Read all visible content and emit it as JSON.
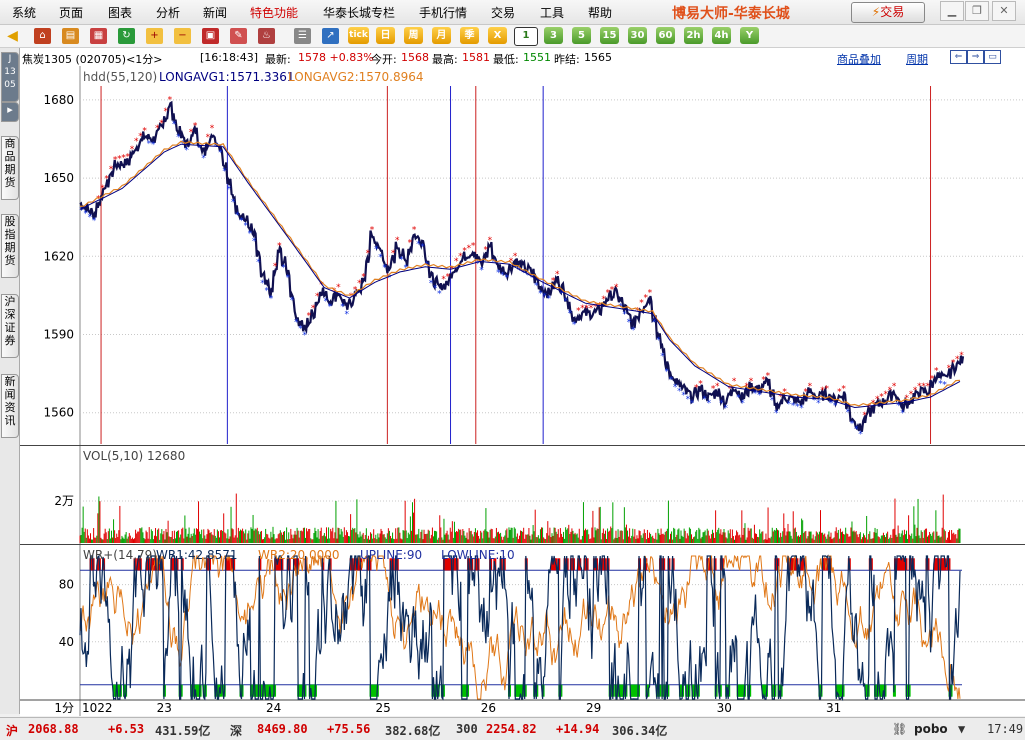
{
  "menu": {
    "items": [
      "系统",
      "页面",
      "图表",
      "分析",
      "新闻",
      "特色功能",
      "华泰长城专栏",
      "手机行情",
      "交易",
      "工具",
      "帮助"
    ],
    "special_index": 5,
    "app_title": "博易大师-华泰长城",
    "trade_button": "交易"
  },
  "toolbar": {
    "icon_labels": [
      "tick",
      "日",
      "周",
      "月",
      "季",
      "X"
    ],
    "periods": [
      "1",
      "3",
      "5",
      "15",
      "30",
      "60",
      "2h",
      "4h",
      "Y"
    ],
    "selected_period": "1"
  },
  "infobar": {
    "contract": "焦炭1305 (020705)<1分>",
    "time": "[16:18:43]",
    "last_label": "最新:",
    "last_value": "1578 +0.83%",
    "open_label": "今开:",
    "open_value": "1568",
    "high_label": "最高:",
    "high_value": "1581",
    "low_label": "最低:",
    "low_value": "1551",
    "prev_label": "昨结:",
    "prev_value": "1565",
    "overlay_link": "商品叠加",
    "period_link": "周期"
  },
  "left_tabs": {
    "code": "J 13 05",
    "tabs": [
      "商品期货",
      "股指期货",
      "沪深证券",
      "新闻资讯"
    ]
  },
  "chart_data": {
    "type": "line",
    "main": {
      "indicator_name": "hdd(55,120)",
      "series": [
        {
          "name": "LONGAVG1",
          "label": "LONGAVG1:1571.3361",
          "color": "#000080"
        },
        {
          "name": "LONGAVG2",
          "label": "LONGAVG2:1570.8964",
          "color": "#e08020"
        }
      ],
      "ylim": [
        1548,
        1693
      ],
      "yticks": [
        1680,
        1650,
        1620,
        1590,
        1560
      ],
      "price_path": [
        [
          0,
          1640
        ],
        [
          3,
          1636
        ],
        [
          5,
          1644
        ],
        [
          8,
          1655
        ],
        [
          11,
          1656
        ],
        [
          13,
          1662
        ],
        [
          15,
          1666
        ],
        [
          17,
          1665
        ],
        [
          19,
          1669
        ],
        [
          21,
          1678
        ],
        [
          23,
          1668
        ],
        [
          25,
          1663
        ],
        [
          27,
          1668
        ],
        [
          29,
          1660
        ],
        [
          31,
          1667
        ],
        [
          33,
          1662
        ],
        [
          35,
          1648
        ],
        [
          37,
          1638
        ],
        [
          39,
          1634
        ],
        [
          41,
          1628
        ],
        [
          43,
          1612
        ],
        [
          45,
          1606
        ],
        [
          47,
          1622
        ],
        [
          49,
          1614
        ],
        [
          51,
          1597
        ],
        [
          53,
          1592
        ],
        [
          55,
          1598
        ],
        [
          57,
          1607
        ],
        [
          59,
          1603
        ],
        [
          61,
          1606
        ],
        [
          63,
          1600
        ],
        [
          65,
          1605
        ],
        [
          67,
          1610
        ],
        [
          69,
          1628
        ],
        [
          71,
          1622
        ],
        [
          73,
          1614
        ],
        [
          75,
          1624
        ],
        [
          77,
          1618
        ],
        [
          79,
          1628
        ],
        [
          81,
          1626
        ],
        [
          83,
          1612
        ],
        [
          85,
          1608
        ],
        [
          87,
          1610
        ],
        [
          89,
          1616
        ],
        [
          91,
          1620
        ],
        [
          93,
          1622
        ],
        [
          95,
          1617
        ],
        [
          97,
          1624
        ],
        [
          99,
          1616
        ],
        [
          101,
          1614
        ],
        [
          103,
          1618
        ],
        [
          105,
          1616
        ],
        [
          107,
          1614
        ],
        [
          109,
          1608
        ],
        [
          111,
          1606
        ],
        [
          113,
          1611
        ],
        [
          115,
          1605
        ],
        [
          117,
          1596
        ],
        [
          119,
          1598
        ],
        [
          121,
          1598
        ],
        [
          123,
          1599
        ],
        [
          125,
          1604
        ],
        [
          127,
          1606
        ],
        [
          129,
          1600
        ],
        [
          131,
          1594
        ],
        [
          133,
          1600
        ],
        [
          135,
          1604
        ],
        [
          137,
          1590
        ],
        [
          139,
          1578
        ],
        [
          141,
          1572
        ],
        [
          143,
          1569
        ],
        [
          145,
          1566
        ],
        [
          147,
          1569
        ],
        [
          149,
          1566
        ],
        [
          151,
          1568
        ],
        [
          153,
          1564
        ],
        [
          155,
          1570
        ],
        [
          157,
          1566
        ],
        [
          159,
          1570
        ],
        [
          161,
          1569
        ],
        [
          163,
          1572
        ],
        [
          165,
          1562
        ],
        [
          167,
          1566
        ],
        [
          169,
          1565
        ],
        [
          171,
          1564
        ],
        [
          173,
          1568
        ],
        [
          175,
          1566
        ],
        [
          177,
          1567
        ],
        [
          179,
          1565
        ],
        [
          181,
          1567
        ],
        [
          183,
          1558
        ],
        [
          185,
          1554
        ],
        [
          187,
          1560
        ],
        [
          189,
          1563
        ],
        [
          191,
          1565
        ],
        [
          193,
          1568
        ],
        [
          195,
          1562
        ],
        [
          197,
          1565
        ],
        [
          199,
          1568
        ],
        [
          201,
          1568
        ],
        [
          203,
          1574
        ],
        [
          205,
          1573
        ],
        [
          207,
          1577
        ],
        [
          209,
          1580
        ]
      ],
      "avg_path": [
        [
          0,
          1638
        ],
        [
          10,
          1646
        ],
        [
          20,
          1660
        ],
        [
          24,
          1663
        ],
        [
          34,
          1662
        ],
        [
          40,
          1648
        ],
        [
          50,
          1626
        ],
        [
          58,
          1608
        ],
        [
          64,
          1604
        ],
        [
          70,
          1610
        ],
        [
          76,
          1614
        ],
        [
          82,
          1616
        ],
        [
          88,
          1615
        ],
        [
          95,
          1618
        ],
        [
          102,
          1617
        ],
        [
          110,
          1610
        ],
        [
          120,
          1602
        ],
        [
          128,
          1600
        ],
        [
          136,
          1598
        ],
        [
          140,
          1588
        ],
        [
          146,
          1578
        ],
        [
          154,
          1570
        ],
        [
          162,
          1568
        ],
        [
          170,
          1566
        ],
        [
          178,
          1565
        ],
        [
          184,
          1562
        ],
        [
          190,
          1563
        ],
        [
          196,
          1564
        ],
        [
          202,
          1566
        ],
        [
          209,
          1572
        ]
      ],
      "red_lines": [
        5,
        73,
        94,
        202
      ],
      "blue_lines": [
        35,
        88,
        110
      ]
    },
    "volume": {
      "label": "VOL(5,10)",
      "value": "12680",
      "ytick": "2万",
      "ylim": [
        0,
        40000
      ]
    },
    "wr": {
      "label": "WR+(14,79)",
      "wr1_label": "WR1:42.8571",
      "wr2_label": "WR2:20.0000",
      "upline_label": "UPLINE:90",
      "lowline_label": "LOWLINE:10",
      "upline": 90,
      "lowline": 10,
      "ylim": [
        0,
        100
      ],
      "yticks": [
        80,
        40
      ],
      "wr1_color": "#0a2a5a",
      "wr2_color": "#e07818"
    },
    "xaxis": {
      "unit": "1分",
      "labels": [
        {
          "text": "1022",
          "i": 0
        },
        {
          "text": "23",
          "i": 20
        },
        {
          "text": "24",
          "i": 46
        },
        {
          "text": "25",
          "i": 72
        },
        {
          "text": "26",
          "i": 97
        },
        {
          "text": "29",
          "i": 122
        },
        {
          "text": "30",
          "i": 153
        },
        {
          "text": "31",
          "i": 179
        }
      ],
      "n": 210
    }
  },
  "statusbar": {
    "sh_label": "沪",
    "sh_index": "2068.88",
    "sh_change": "+6.53",
    "sh_amount": "431.59亿",
    "sz_label": "深",
    "sz_index": "8469.80",
    "sz_change": "+75.56",
    "sz_amount": "382.68亿",
    "hs300_label": "300",
    "hs300_index": "2254.82",
    "hs300_change": "+14.94",
    "hs300_amount": "306.34亿",
    "brand": "pobo",
    "clock": "17:49"
  },
  "colors": {
    "up": "#d00000",
    "down": "#008800",
    "title": "#e0501a",
    "link": "#0033aa"
  }
}
